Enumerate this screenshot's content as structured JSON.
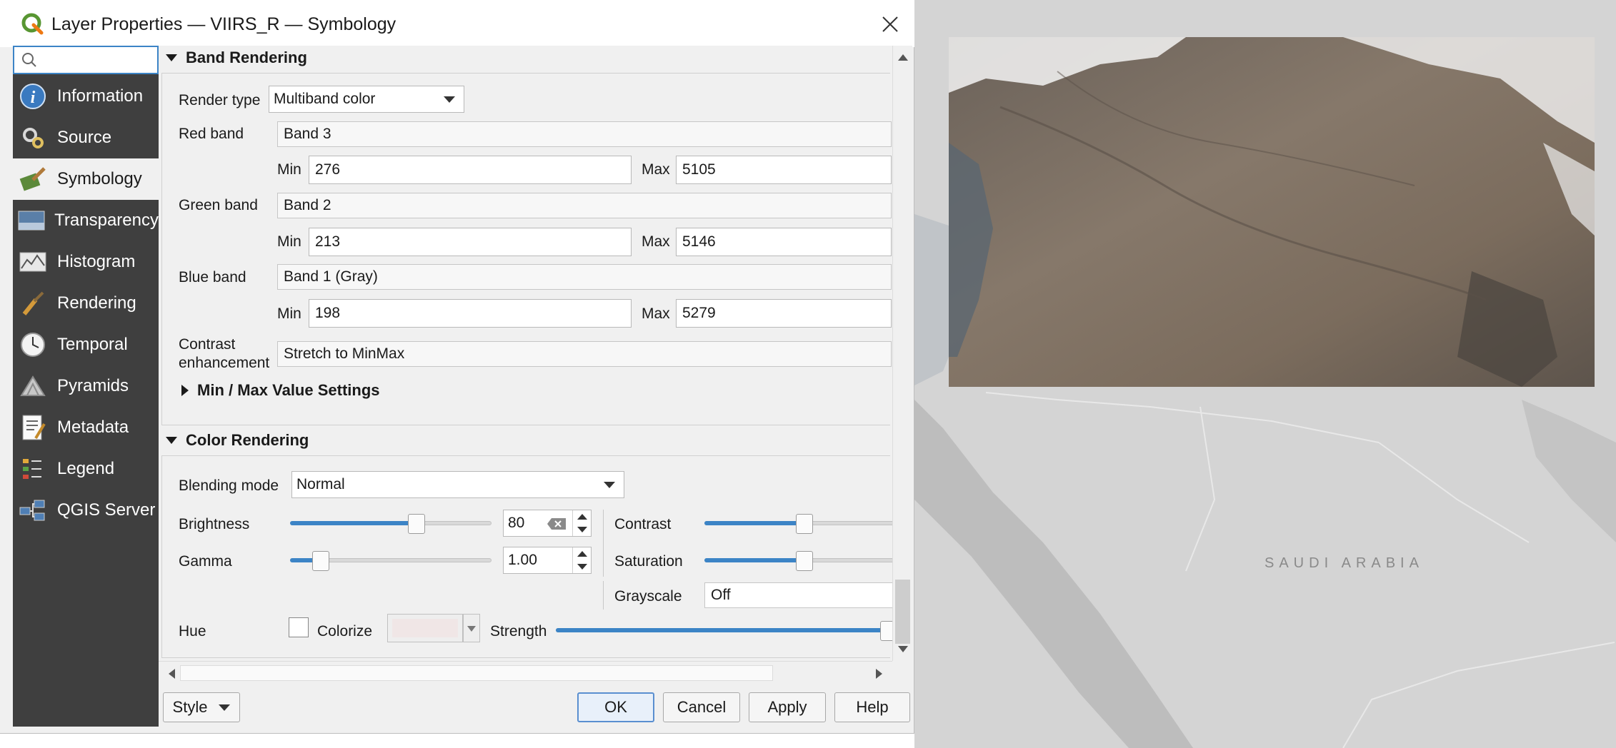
{
  "window": {
    "title": "Layer Properties — VIIRS_R — Symbology",
    "close_icon": "close-icon"
  },
  "sidebar": {
    "search_value": "",
    "items": [
      {
        "label": "Information",
        "icon": "info-icon"
      },
      {
        "label": "Source",
        "icon": "source-icon"
      },
      {
        "label": "Symbology",
        "icon": "symbology-icon",
        "active": true
      },
      {
        "label": "Transparency",
        "icon": "transparency-icon"
      },
      {
        "label": "Histogram",
        "icon": "histogram-icon"
      },
      {
        "label": "Rendering",
        "icon": "rendering-icon"
      },
      {
        "label": "Temporal",
        "icon": "clock-icon"
      },
      {
        "label": "Pyramids",
        "icon": "pyramids-icon"
      },
      {
        "label": "Metadata",
        "icon": "metadata-icon"
      },
      {
        "label": "Legend",
        "icon": "legend-icon"
      },
      {
        "label": "QGIS Server",
        "icon": "server-icon"
      }
    ]
  },
  "band_rendering": {
    "header": "Band Rendering",
    "render_type_label": "Render type",
    "render_type_value": "Multiband color",
    "red_band_label": "Red band",
    "red_band_value": "Band 3",
    "red_min": "276",
    "red_max": "5105",
    "green_band_label": "Green band",
    "green_band_value": "Band 2",
    "green_min": "213",
    "green_max": "5146",
    "blue_band_label": "Blue band",
    "blue_band_value": "Band 1 (Gray)",
    "blue_min": "198",
    "blue_max": "5279",
    "min_label": "Min",
    "max_label": "Max",
    "contrast_label_line1": "Contrast",
    "contrast_label_line2": "enhancement",
    "contrast_value": "Stretch to MinMax",
    "minmax_settings_header": "Min / Max Value Settings"
  },
  "color_rendering": {
    "header": "Color Rendering",
    "blending_mode_label": "Blending mode",
    "blending_mode_value": "Normal",
    "brightness_label": "Brightness",
    "brightness_value": "80",
    "brightness_slider_fraction": 0.64,
    "contrast_label": "Contrast",
    "contrast_slider_fraction": 0.5,
    "gamma_label": "Gamma",
    "gamma_value": "1.00",
    "gamma_slider_fraction": 0.12,
    "saturation_label": "Saturation",
    "saturation_slider_fraction": 0.5,
    "grayscale_label": "Grayscale",
    "grayscale_value": "Off",
    "hue_label": "Hue",
    "colorize_label": "Colorize",
    "colorize_checked": false,
    "colorize_color": "#f0e6e6",
    "strength_label": "Strength",
    "strength_slider_fraction": 1.0
  },
  "footer": {
    "style_label": "Style",
    "ok_label": "OK",
    "cancel_label": "Cancel",
    "apply_label": "Apply",
    "help_label": "Help"
  },
  "map": {
    "country_label": "SAUDI ARABIA",
    "layer_name": "VIIRS_R",
    "accent": "#3c84c6"
  }
}
